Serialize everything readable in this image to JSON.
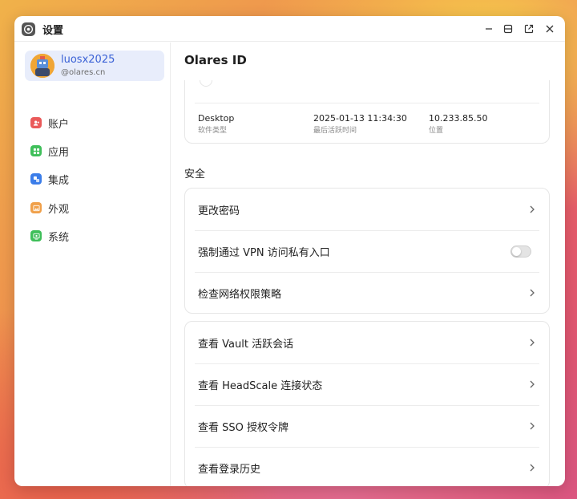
{
  "window": {
    "title": "设置",
    "app_icon": "settings-app-icon"
  },
  "window_controls": [
    "minimize-icon",
    "maximize-icon",
    "popout-icon",
    "close-icon"
  ],
  "sidebar": {
    "profile": {
      "name": "luosx2025",
      "domain": "@olares.cn"
    },
    "items": [
      {
        "label": "账户",
        "icon": "account-icon",
        "color": "#ea5a5a"
      },
      {
        "label": "应用",
        "icon": "apps-icon",
        "color": "#3fbf5a"
      },
      {
        "label": "集成",
        "icon": "integration-icon",
        "color": "#3b7de9"
      },
      {
        "label": "外观",
        "icon": "appearance-icon",
        "color": "#f0a04a"
      },
      {
        "label": "系统",
        "icon": "system-icon",
        "color": "#3fbf5a"
      }
    ]
  },
  "main": {
    "title": "Olares ID",
    "device": {
      "software_value": "Desktop",
      "software_label": "软件类型",
      "last_active_value": "2025-01-13 11:34:30",
      "last_active_label": "最后活跃时间",
      "location_value": "10.233.85.50",
      "location_label": "位置"
    },
    "security_section": "安全",
    "security_rows": [
      {
        "label": "更改密码",
        "control": "chevron"
      },
      {
        "label": "强制通过 VPN 访问私有入口",
        "control": "toggle",
        "toggle_on": false
      },
      {
        "label": "检查网络权限策略",
        "control": "chevron"
      }
    ],
    "session_rows": [
      {
        "label": "查看 Vault 活跃会话"
      },
      {
        "label": "查看 HeadScale 连接状态"
      },
      {
        "label": "查看 SSO 授权令牌"
      },
      {
        "label": "查看登录历史"
      }
    ]
  }
}
